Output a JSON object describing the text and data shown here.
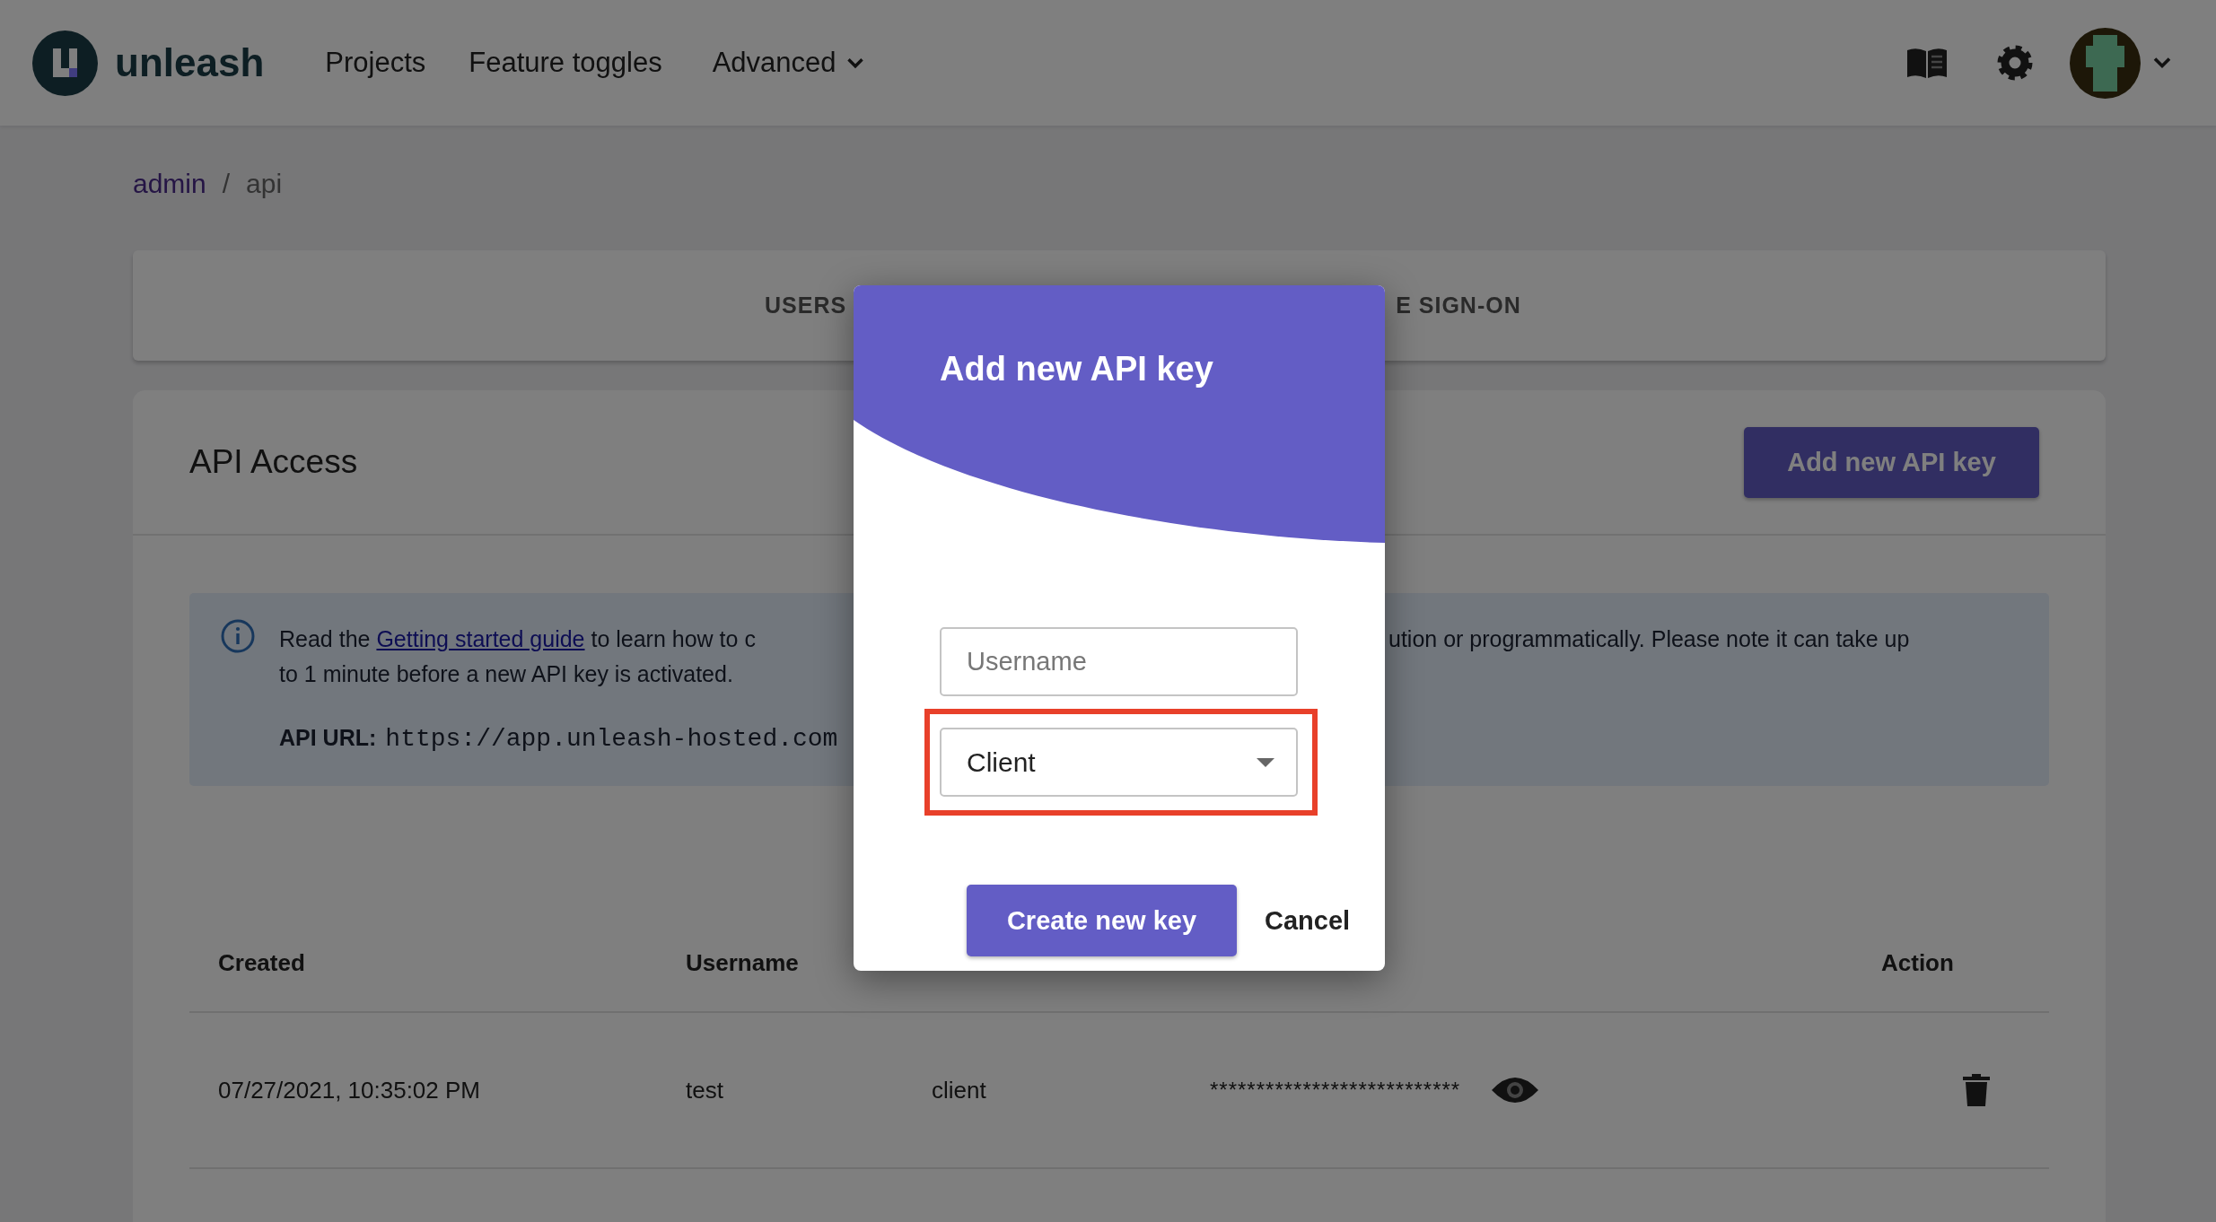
{
  "header": {
    "brand": "unleash",
    "nav": [
      {
        "label": "Projects",
        "kind": "link"
      },
      {
        "label": "Feature toggles",
        "kind": "link"
      },
      {
        "label": "Advanced",
        "kind": "menu"
      }
    ]
  },
  "breadcrumb": [
    {
      "label": "admin",
      "kind": "link"
    },
    {
      "label": "/",
      "kind": "separator"
    },
    {
      "label": "api",
      "kind": "current"
    }
  ],
  "tabs": [
    {
      "label": "USERS"
    },
    {
      "label": "E SIGN-ON"
    }
  ],
  "api_access": {
    "title": "API Access",
    "add_button": "Add new API key",
    "info": {
      "lead": "Read the",
      "link": "Getting started guide",
      "text_left": "to learn how to c",
      "text_right": "ution or programmatically. Please note it can take up",
      "line_2": "to 1 minute before a new API key is activated.",
      "url_label": "API URL:",
      "url": "https://app.unleash-hosted.com"
    },
    "table": {
      "columns": [
        "Created",
        "Username",
        "Action"
      ],
      "rows": [
        {
          "created": "07/27/2021, 10:35:02 PM",
          "username": "test",
          "type": "client",
          "secret": "***************************"
        }
      ]
    }
  },
  "modal": {
    "title": "Add new API key",
    "username": {
      "placeholder": "Username"
    },
    "type_select": {
      "value": "Client",
      "highlighted": true
    },
    "create_button": "Create new key",
    "cancel_button": "Cancel"
  }
}
